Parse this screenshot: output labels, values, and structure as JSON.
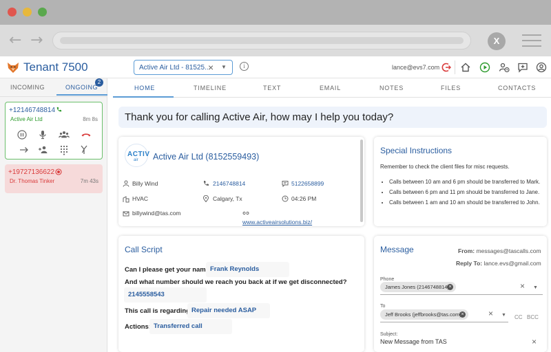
{
  "browser": {
    "close_label": "X"
  },
  "header": {
    "title": "Tenant 7500",
    "company_select": "Active Air Ltd - 81525...",
    "user_email": "lance@evs7.com"
  },
  "left_tabs": {
    "incoming": "INCOMING",
    "ongoing": "ONGOING",
    "ongoing_count": "2"
  },
  "calls": [
    {
      "number": "+12146748814",
      "name": "Active Air Ltd",
      "duration": "8m 8s",
      "status_color": "#2c9a2c"
    },
    {
      "number": "+19727136622",
      "name": "Dr. Thomas Tinker",
      "duration": "7m 43s",
      "status_color": "#d93b3b"
    }
  ],
  "tabs": [
    "HOME",
    "TIMELINE",
    "TEXT",
    "EMAIL",
    "NOTES",
    "FILES",
    "CONTACTS"
  ],
  "greeting": "Thank you for calling Active Air, how may I help you today?",
  "company": {
    "logo_text": "ACTIV",
    "logo_sub": "air",
    "name": "Active Air Ltd (8152559493)",
    "contact": "Billy Wind",
    "phone": "2146748814",
    "fax": "5122658899",
    "industry": "HVAC",
    "location": "Calgary, Tx",
    "time": "04:26 PM",
    "email": "billywind@tas.com",
    "website": "www.activeairsolutions.biz/"
  },
  "instructions": {
    "title": "Special Instructions",
    "intro": "Remember to check the client files for misc requests.",
    "items": [
      "Calls between 10 am and 6 pm should be transferred to Mark.",
      "Calls between 6 pm and 11 pm should be transferred to Jane.",
      "Calls between 1 am and 10 am should be transferred to John."
    ]
  },
  "script": {
    "title": "Call Script",
    "q1": "Can I please get your name?",
    "a1": "Frank Reynolds",
    "q2": "And what number should we reach you back at if we get disconnected?",
    "a2": "2145558543",
    "q3": "This call is regarding?",
    "a3": "Repair needed ASAP",
    "q4": "Actions:",
    "a4": "Transferred call"
  },
  "message": {
    "title": "Message",
    "from_label": "From:",
    "from": "messages@tascalls.com",
    "reply_label": "Reply To:",
    "reply_to": "lance.evs@gmail.com",
    "phone_label": "Phone",
    "phone_chip": "James Jones (2146748814)",
    "to_label": "To",
    "to_chip": "Jeff Brooks (jeffbrooks@tas.com)",
    "cc": "CC",
    "bcc": "BCC",
    "subject_label": "Subject:",
    "subject": "New Message from TAS"
  },
  "colors": {
    "accent": "#2a5d9f",
    "active_tab_line": "#5b9bd5",
    "call_active": "#6bbf6b",
    "call_waiting": "#f6dada",
    "hangup": "#d93b3b"
  }
}
